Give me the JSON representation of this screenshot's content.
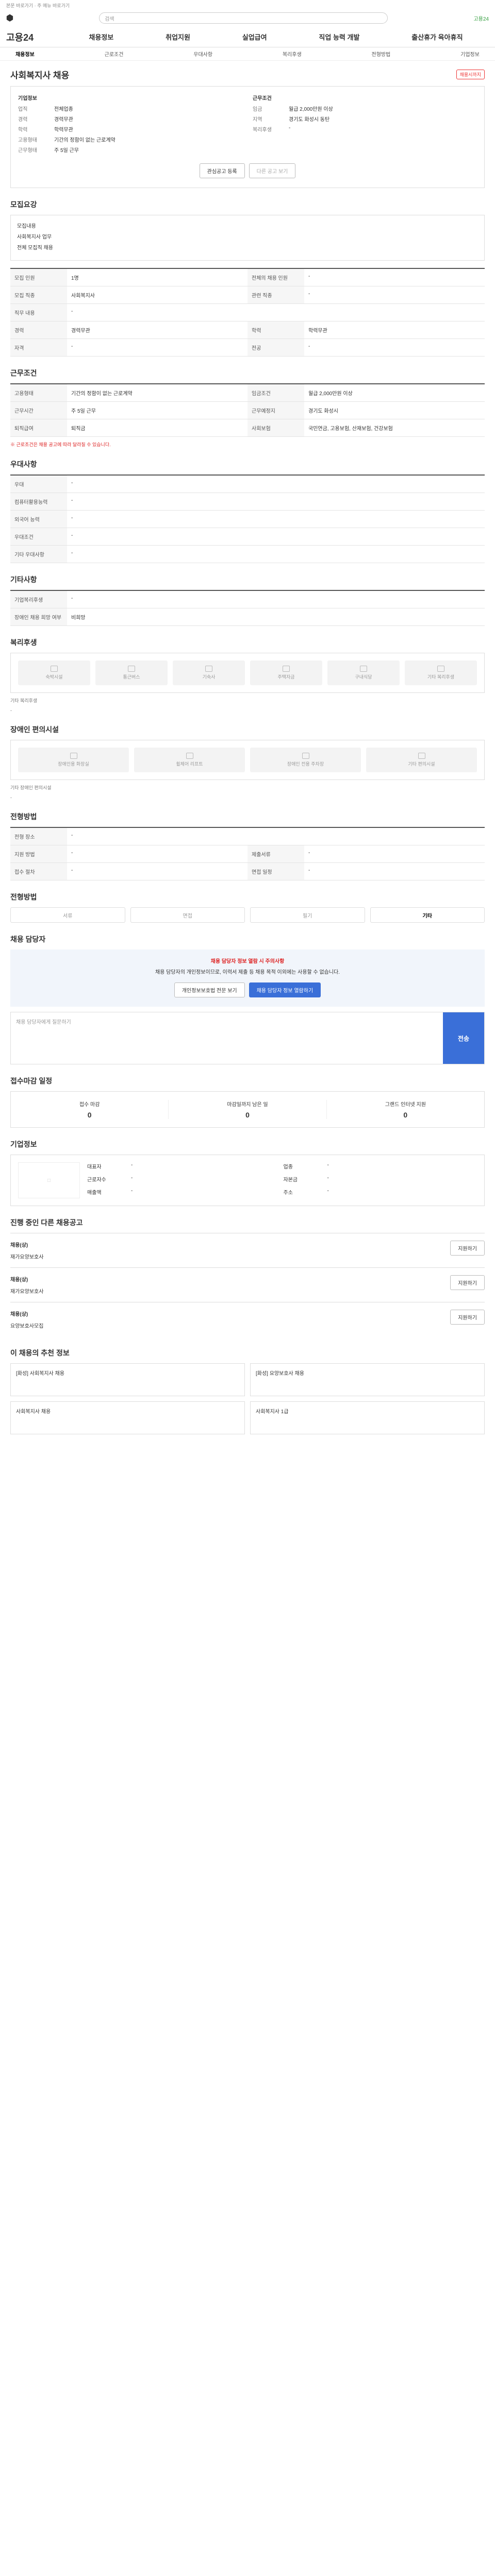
{
  "skip": "본문 바로가기 · 주 메뉴 바로가기",
  "topbar": {
    "search_placeholder": "검색",
    "right": "고용24"
  },
  "gnb": {
    "brand": "고용24",
    "menu": [
      "채용정보",
      "취업지원",
      "실업급여",
      "직업 능력 개발",
      "출산휴가 육아휴직"
    ]
  },
  "subnav": [
    "채용정보",
    "근로조건",
    "우대사항",
    "복리후생",
    "전형방법",
    "기업정보"
  ],
  "job": {
    "title": "사회복지사 채용",
    "badge": "채용시까지",
    "left_group": "기업정보",
    "left": [
      [
        "업직",
        "전체업종"
      ],
      [
        "경력",
        "경력무관"
      ],
      [
        "학력",
        "학력무관"
      ],
      [
        "고용형태",
        "기간의 정함이 없는 근로계약"
      ],
      [
        "근무형태",
        "주 5일 근무"
      ]
    ],
    "right_group": "근무조건",
    "right": [
      [
        "임금",
        "월급 2,000만원 이상"
      ],
      [
        "지역",
        "경기도 화성시 동탄"
      ],
      [
        "복리후생",
        "-"
      ]
    ],
    "btn_apply": "관심공고 등록",
    "btn_share": "다른 공고 보기"
  },
  "summary": {
    "title": "모집요강",
    "lines": [
      "모집내용",
      "사회복지사 업무",
      "전체 모집직 채용"
    ]
  },
  "recruit": {
    "rows": [
      [
        "모집 인원",
        "1명",
        "전체의 채용 인원",
        "-"
      ],
      [
        "모집 직종",
        "사회복지사",
        "관련 직종",
        "-"
      ],
      [
        "직무 내용",
        "-",
        "",
        ""
      ],
      [
        "경력",
        "경력무관",
        "학력",
        "학력무관"
      ],
      [
        "자격",
        "-",
        "전공",
        "-"
      ]
    ]
  },
  "conditions": {
    "title": "근무조건",
    "rows": [
      [
        "고용형태",
        "기간의 정함이 없는 근로계약",
        "임금조건",
        "월급 2,000만원 이상"
      ],
      [
        "근무시간",
        "주 5일 근무",
        "근무예정지",
        "경기도 화성시"
      ],
      [
        "퇴직급여",
        "퇴직금",
        "사회보험",
        "국민연금, 고용보험, 산재보험, 건강보험"
      ]
    ],
    "note": "※ 근로조건은 채용 공고에 따라 달라질 수 있습니다."
  },
  "preference": {
    "title": "우대사항",
    "rows": [
      [
        "우대",
        "-"
      ],
      [
        "컴퓨터활용능력",
        "-"
      ],
      [
        "외국어 능력",
        "-"
      ],
      [
        "우대조건",
        "-"
      ],
      [
        "기타 우대사항",
        "-"
      ]
    ]
  },
  "extra": {
    "title": "기타사항",
    "rows": [
      [
        "기업복리후생",
        "-"
      ],
      [
        "장애인 채용 희망 여부",
        "비희망"
      ]
    ]
  },
  "welfare": {
    "title": "복리후생",
    "items": [
      "숙박시설",
      "통근버스",
      "기숙사",
      "주택자금",
      "구내식당",
      "기타 복리후생"
    ],
    "note": "기타 복리후생",
    "value": "-"
  },
  "disabled": {
    "title": "장애인 편의시설",
    "items": [
      "장애인용 화장실",
      "휠체어 리프트",
      "장애인 전용 주차장",
      "기타 편의시설"
    ],
    "note": "기타 장애인 편의시설",
    "value": "-"
  },
  "method": {
    "title": "전형방법",
    "rows": [
      [
        "전형 장소",
        "-",
        "",
        ""
      ],
      [
        "지원 방법",
        "-",
        "제출서류",
        "-"
      ],
      [
        "접수 절차",
        "-",
        "면접 일정",
        "-"
      ]
    ]
  },
  "process": {
    "title": "전형방법",
    "steps": [
      "서류",
      "면접",
      "필기",
      "기타"
    ]
  },
  "contact": {
    "title": "채용 담당자",
    "warn": "채용 담당자 정보 열람 시 주의사항",
    "msg": "채용 담당자의 개인정보이므로, 이력서 제출 등 채용 목적 이외에는 사용할 수 없습니다.",
    "btn1": "개인정보보호법 전문 보기",
    "btn2": "채용 담당자 정보 열람하기"
  },
  "qa": {
    "placeholder": "채용 담당자에게 질문하기",
    "send": "전송"
  },
  "deadline": {
    "title": "접수마감 일정",
    "items": [
      [
        "접수 마감",
        "0"
      ],
      [
        "마감일까지 남은 일",
        "0"
      ],
      [
        "그랜드 인터넷 지원",
        "0"
      ]
    ]
  },
  "company_title": "기업정보",
  "company": [
    [
      "대표자",
      "-"
    ],
    [
      "업종",
      "-"
    ],
    [
      "근로자수",
      "-"
    ],
    [
      "자본금",
      "-"
    ],
    [
      "매출액",
      "-"
    ],
    [
      "주소",
      "-"
    ]
  ],
  "joblist": {
    "title": "진행 중인 다른 채용공고",
    "items": [
      [
        "채용(상)",
        "재가요양보호사"
      ],
      [
        "채용(상)",
        "재가요양보호사"
      ],
      [
        "채용(상)",
        "요양보호사모집"
      ]
    ],
    "btn": "지원하기"
  },
  "recommend": {
    "title": "이 채용의 추천 정보",
    "items": [
      "[화성] 사회복지사 채용",
      "[화성] 요양보호사 채용",
      "사회복지사 채용",
      "사회복지사 1급"
    ]
  }
}
